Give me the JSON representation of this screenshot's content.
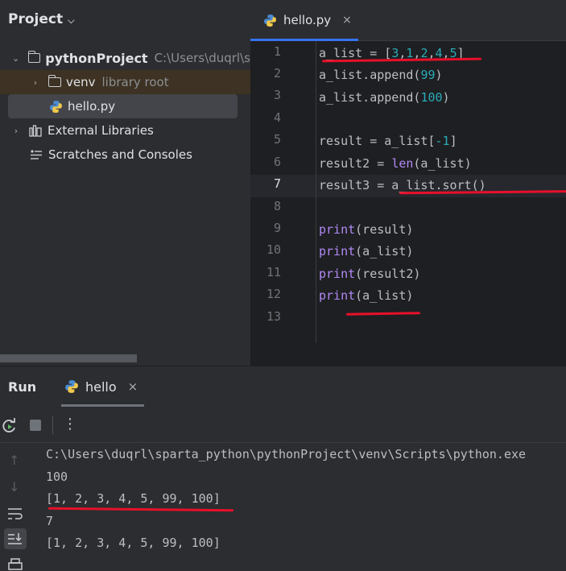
{
  "project_panel": {
    "title": "Project",
    "tree": {
      "root": {
        "name": "pythonProject",
        "path": "C:\\Users\\duqrl\\s"
      },
      "venv": {
        "name": "venv",
        "hint": "library root"
      },
      "file": {
        "name": "hello.py"
      },
      "external": {
        "name": "External Libraries"
      },
      "scratches": {
        "name": "Scratches and Consoles"
      }
    }
  },
  "editor": {
    "tab": {
      "label": "hello.py",
      "close": "×"
    },
    "line_numbers": [
      "1",
      "2",
      "3",
      "4",
      "5",
      "6",
      "7",
      "8",
      "9",
      "10",
      "11",
      "12",
      "13"
    ],
    "current_line": 7
  },
  "run_panel": {
    "title": "Run",
    "tab": {
      "label": "hello",
      "close": "×"
    },
    "menu_glyph": "⋮",
    "output": [
      "C:\\Users\\duqrl\\sparta_python\\pythonProject\\venv\\Scripts\\python.exe",
      "100",
      "[1, 2, 3, 4, 5, 99, 100]",
      "7",
      "[1, 2, 3, 4, 5, 99, 100]"
    ]
  },
  "code": {
    "l1": {
      "a": "a_list = [",
      "n1": "3",
      "c1": ",",
      "n2": "1",
      "c2": ",",
      "n3": "2",
      "c3": ",",
      "n4": "4",
      "c4": ",",
      "n5": "5",
      "b": "]"
    },
    "l2": {
      "a": "a_list.append(",
      "n": "99",
      "b": ")"
    },
    "l3": {
      "a": "a_list.append(",
      "n": "100",
      "b": ")"
    },
    "l5": {
      "a": "result = a_list[",
      "n": "-1",
      "b": "]"
    },
    "l6": {
      "a": "result2 = ",
      "f": "len",
      "b": "(a_list)"
    },
    "l7": {
      "a": "result3 = a_list.sort()"
    },
    "l9": {
      "f": "print",
      "b": "(result)"
    },
    "l10": {
      "f": "print",
      "b": "(a_list)"
    },
    "l11": {
      "f": "print",
      "b": "(result2)"
    },
    "l12": {
      "f": "print",
      "b": "(a_list)"
    }
  },
  "colors": {
    "accent": "#3574f0",
    "annotation_red": "#e8102a",
    "number": "#2aacb8",
    "builtin": "#b189f5"
  },
  "icons": [
    "python-file-icon",
    "folder-icon",
    "library-icon",
    "scratches-icon",
    "rerun-icon",
    "stop-icon",
    "more-icon",
    "up-icon",
    "down-icon",
    "soft-wrap-icon",
    "scroll-to-end-icon",
    "print-icon"
  ]
}
